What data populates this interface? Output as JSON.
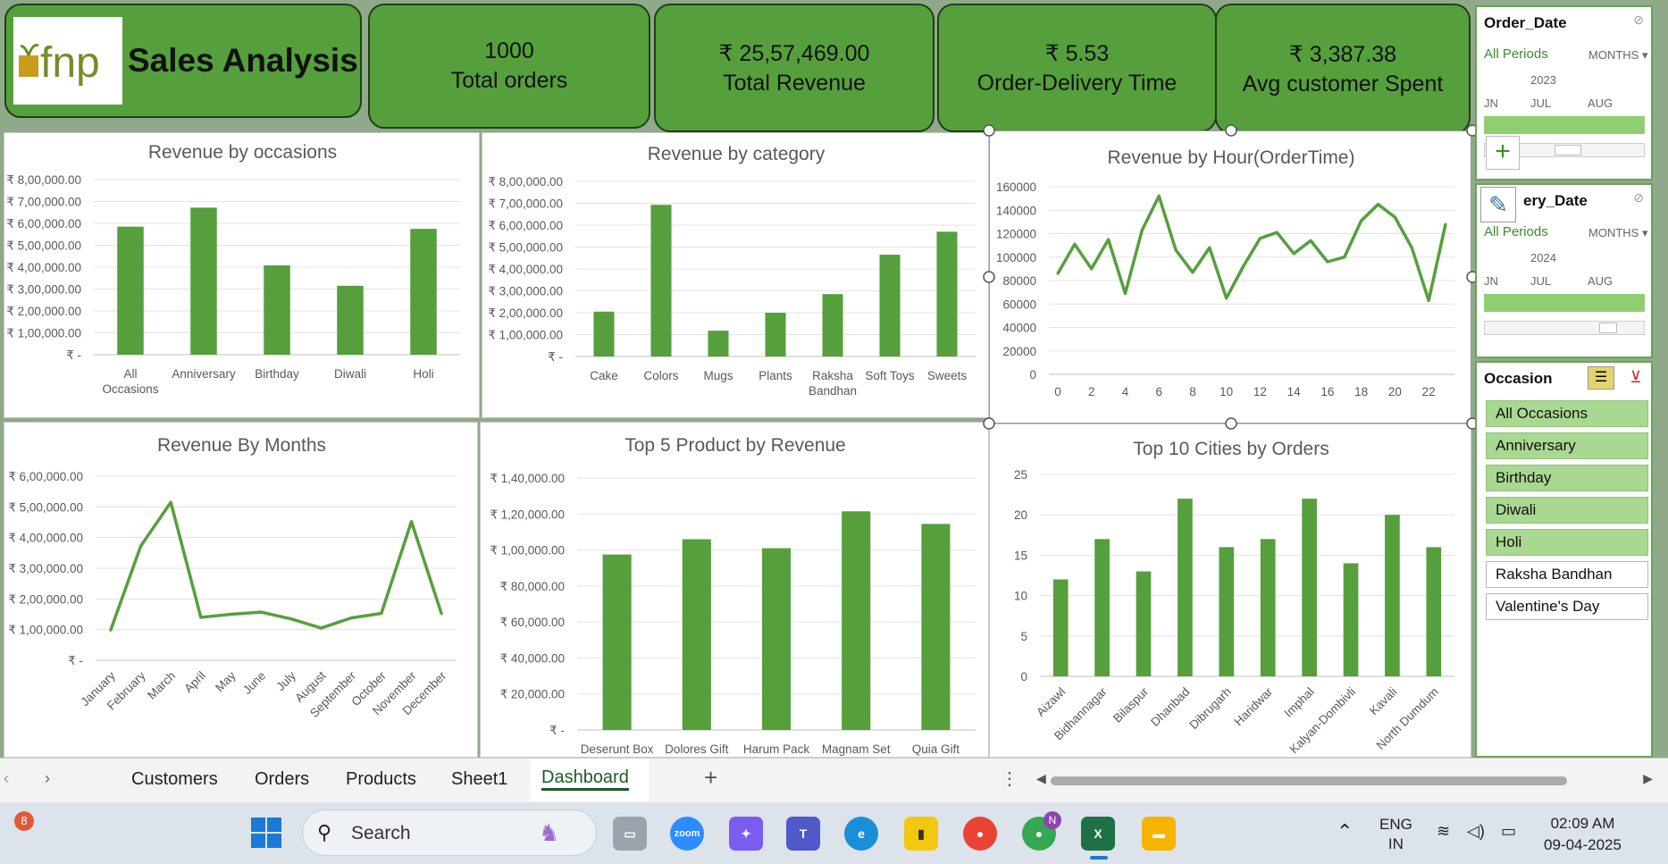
{
  "header": {
    "title": "Sales Analysis",
    "logo_text": "fnp"
  },
  "kpis": [
    {
      "value": "1000",
      "label": "Total orders"
    },
    {
      "value": "₹ 25,57,469.00",
      "label": "Total Revenue"
    },
    {
      "value": "₹ 5.53",
      "label": "Order-Delivery Time"
    },
    {
      "value": "₹ 3,387.38",
      "label": "Avg  customer Spent"
    }
  ],
  "colors": {
    "accent": "#55a03c",
    "bar": "#55a03c",
    "selected_item": "#a9d892"
  },
  "chart_data": [
    {
      "type": "bar",
      "title": "Revenue by occasions",
      "categories": [
        "All Occasions",
        "Anniversary",
        "Birthday",
        "Diwali",
        "Holi"
      ],
      "category_lines": [
        [
          "All",
          "Occasions"
        ],
        [
          "Anniversary"
        ],
        [
          "Birthday"
        ],
        [
          "Diwali"
        ],
        [
          "Holi"
        ]
      ],
      "values": [
        585000,
        672000,
        408000,
        315000,
        575000
      ],
      "ylim": [
        0,
        800000
      ],
      "yticks": [
        "₹ -",
        "₹ 1,00,000.00",
        "₹ 2,00,000.00",
        "₹ 3,00,000.00",
        "₹ 4,00,000.00",
        "₹ 5,00,000.00",
        "₹ 6,00,000.00",
        "₹ 7,00,000.00",
        "₹ 8,00,000.00"
      ],
      "grid": true
    },
    {
      "type": "bar",
      "title": "Revenue by category",
      "categories": [
        "Cake",
        "Colors",
        "Mugs",
        "Plants",
        "Raksha Bandhan",
        "Soft Toys",
        "Sweets"
      ],
      "category_lines": [
        [
          "Cake"
        ],
        [
          "Colors"
        ],
        [
          "Mugs"
        ],
        [
          "Plants"
        ],
        [
          "Raksha",
          "Bandhan"
        ],
        [
          "Soft Toys"
        ],
        [
          "Sweets"
        ]
      ],
      "values": [
        205000,
        693000,
        118000,
        200000,
        285000,
        465000,
        570000
      ],
      "ylim": [
        0,
        800000
      ],
      "yticks": [
        "₹ -",
        "₹ 1,00,000.00",
        "₹ 2,00,000.00",
        "₹ 3,00,000.00",
        "₹ 4,00,000.00",
        "₹ 5,00,000.00",
        "₹ 6,00,000.00",
        "₹ 7,00,000.00",
        "₹ 8,00,000.00"
      ],
      "grid": true
    },
    {
      "type": "line",
      "title": "Revenue by Hour(OrderTime)",
      "x": [
        0,
        1,
        2,
        3,
        4,
        5,
        6,
        7,
        8,
        9,
        10,
        11,
        12,
        13,
        14,
        15,
        16,
        17,
        18,
        19,
        20,
        21,
        22,
        23
      ],
      "xticks": [
        "0",
        "2",
        "4",
        "6",
        "8",
        "10",
        "12",
        "14",
        "16",
        "18",
        "20",
        "22"
      ],
      "values": [
        86000,
        111000,
        90000,
        115000,
        69000,
        123000,
        152000,
        106000,
        87000,
        108000,
        65000,
        92000,
        116000,
        121000,
        103000,
        114000,
        96000,
        100000,
        131000,
        145000,
        134000,
        108000,
        63000,
        128000
      ],
      "ylim": [
        0,
        160000
      ],
      "yticks": [
        "0",
        "20000",
        "40000",
        "60000",
        "80000",
        "100000",
        "120000",
        "140000",
        "160000"
      ],
      "grid": true
    },
    {
      "type": "line",
      "title": "Revenue By Months",
      "categories": [
        "January",
        "February",
        "March",
        "April",
        "May",
        "June",
        "July",
        "August",
        "September",
        "October",
        "November",
        "December"
      ],
      "values": [
        98000,
        372000,
        515000,
        140000,
        150000,
        157000,
        135000,
        105000,
        138000,
        153000,
        452000,
        152000
      ],
      "ylim": [
        0,
        600000
      ],
      "yticks": [
        "₹ -",
        "₹ 1,00,000.00",
        "₹ 2,00,000.00",
        "₹ 3,00,000.00",
        "₹ 4,00,000.00",
        "₹ 5,00,000.00",
        "₹ 6,00,000.00"
      ],
      "grid": true
    },
    {
      "type": "bar",
      "title": "Top 5 Product by Revenue",
      "categories": [
        "Deserunt Box",
        "Dolores Gift",
        "Harum Pack",
        "Magnam Set",
        "Quia Gift"
      ],
      "category_lines": [
        [
          "Deserunt Box"
        ],
        [
          "Dolores Gift"
        ],
        [
          "Harum Pack"
        ],
        [
          "Magnam Set"
        ],
        [
          "Quia Gift"
        ]
      ],
      "values": [
        97500,
        106000,
        101000,
        121500,
        114500
      ],
      "ylim": [
        0,
        140000
      ],
      "yticks": [
        "₹ -",
        "₹ 20,000.00",
        "₹ 40,000.00",
        "₹ 60,000.00",
        "₹ 80,000.00",
        "₹ 1,00,000.00",
        "₹ 1,20,000.00",
        "₹ 1,40,000.00"
      ],
      "grid": true
    },
    {
      "type": "bar",
      "title": "Top 10 Cities by Orders",
      "categories": [
        "Aizawl",
        "Bidhannagar",
        "Bilaspur",
        "Dhanbad",
        "Dibrugarh",
        "Haridwar",
        "Imphal",
        "Kalyan-Dombivli",
        "Kavali",
        "North Dumdum"
      ],
      "values": [
        12,
        17,
        13,
        22,
        16,
        17,
        22,
        14,
        20,
        16
      ],
      "ylim": [
        0,
        25
      ],
      "yticks": [
        "0",
        "5",
        "10",
        "15",
        "20",
        "25"
      ],
      "grid": true
    }
  ],
  "slicers": {
    "order_date": {
      "title": "Order_Date",
      "periods": "All Periods",
      "unit": "MONTHS",
      "year": "2023",
      "months": [
        "JN",
        "JUL",
        "AUG"
      ]
    },
    "delivery_date": {
      "title": "ery_Date",
      "periods": "All Periods",
      "unit": "MONTHS",
      "year": "2024",
      "months": [
        "JN",
        "JUL",
        "AUG"
      ]
    },
    "occasion": {
      "title": "Occasion",
      "items": [
        {
          "label": "All Occasions",
          "selected": true
        },
        {
          "label": "Anniversary",
          "selected": true
        },
        {
          "label": "Birthday",
          "selected": true
        },
        {
          "label": "Diwali",
          "selected": true
        },
        {
          "label": "Holi",
          "selected": true
        },
        {
          "label": "Raksha Bandhan",
          "selected": false
        },
        {
          "label": "Valentine's Day",
          "selected": false
        }
      ]
    }
  },
  "sheet_tabs": [
    "Customers",
    "Orders",
    "Products",
    "Sheet1",
    "Dashboard"
  ],
  "active_sheet": "Dashboard",
  "taskbar": {
    "notification_count": "8",
    "search_placeholder": "Search",
    "lang_top": "ENG",
    "lang_bottom": "IN",
    "time": "02:09 AM",
    "date": "09-04-2025",
    "chrome_badge": "N"
  }
}
